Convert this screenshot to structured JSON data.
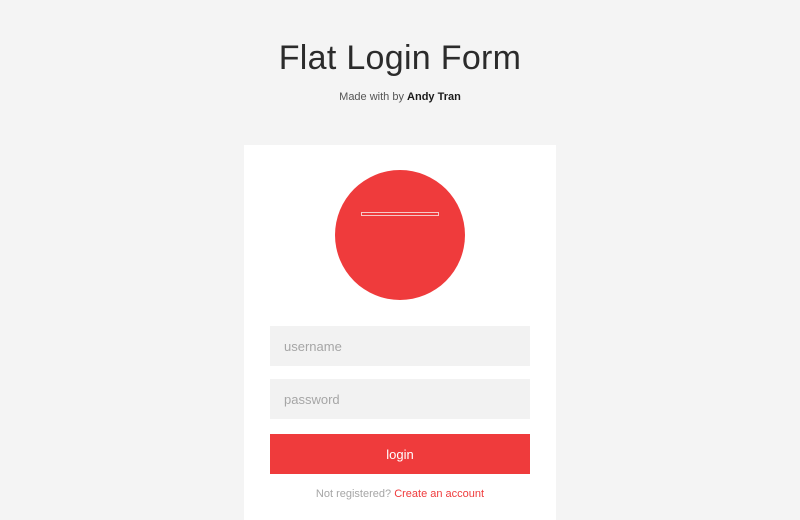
{
  "header": {
    "title": "Flat Login Form",
    "subtitle_prefix": "Made with by",
    "author": "Andy Tran"
  },
  "form": {
    "username_placeholder": "username",
    "username_value": "",
    "password_placeholder": "password",
    "password_value": "",
    "login_label": "login",
    "register_prompt": "Not registered?",
    "register_link": "Create an account"
  },
  "icons": {
    "avatar": "avatar-placeholder-icon"
  },
  "colors": {
    "accent": "#ef3b3c",
    "background": "#f4f4f4",
    "card": "#ffffff",
    "field": "#f2f2f2"
  }
}
